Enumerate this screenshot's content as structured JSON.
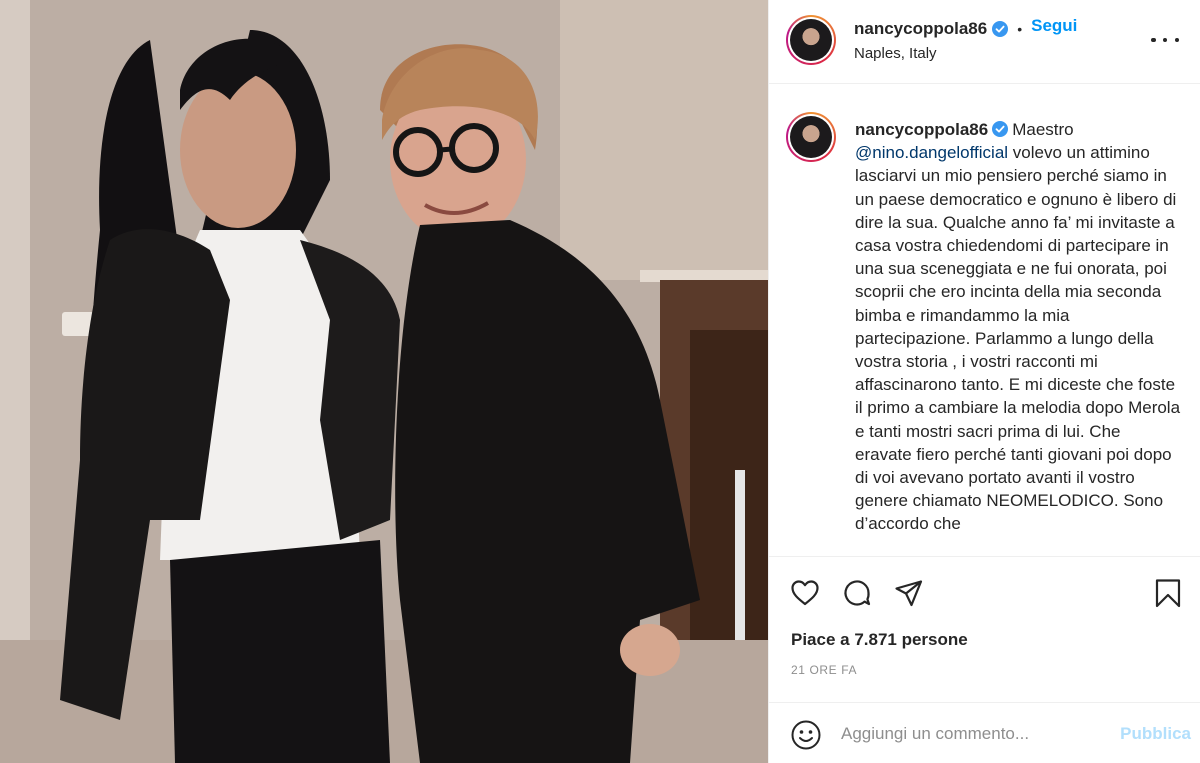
{
  "photo": {
    "alt_icon": "post-photo"
  },
  "header": {
    "username": "nancycoppola86",
    "dot": "•",
    "follow_label": "Segui",
    "location": "Naples, Italy",
    "more_icon": "more-options-icon"
  },
  "caption": {
    "username": "nancycoppola86",
    "text_before_mention": "Maestro",
    "mention": "@nino.dangelofficial",
    "text_after_mention": "volevo un attimino lasciarvi un mio pensiero perché siamo in un paese democratico e ognuno è libero di dire la sua. Qualche anno fa’ mi invitaste a casa vostra chiedendomi di partecipare in una sua sceneggiata e ne fui onorata, poi scoprii che ero incinta della mia seconda bimba e rimandammo la mia partecipazione. Parlammo a lungo della vostra storia , i vostri racconti mi affascinarono tanto. E mi diceste che foste il primo a cambiare la melodia dopo Merola e tanti mostri sacri prima di lui. Che eravate fiero perché tanti giovani poi dopo di voi avevano portato avanti il vostro genere chiamato NEOMELODICO. Sono d’accordo che"
  },
  "actions": {
    "like_icon": "heart-icon",
    "comment_icon": "comment-icon",
    "share_icon": "paper-plane-icon",
    "save_icon": "bookmark-icon"
  },
  "likes": "Piace a 7.871 persone",
  "timestamp": "21 ORE FA",
  "comment_box": {
    "placeholder": "Aggiungi un commento...",
    "publish_label": "Pubblica"
  },
  "colors": {
    "accent": "#0095f6",
    "publish_disabled": "#b2dffc",
    "mention": "#00376b",
    "verified": "#3897f0"
  }
}
